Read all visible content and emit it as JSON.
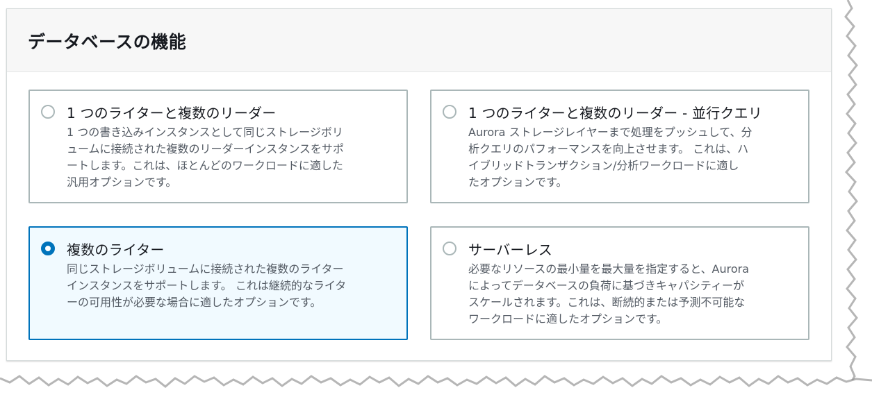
{
  "section": {
    "title": "データベースの機能"
  },
  "options": [
    {
      "title": "1 つのライターと複数のリーダー",
      "description_lines": [
        "1 つの書き込みインスタンスとして同じストレージボリ",
        "ュームに接続された複数のリーダーインスタンスをサポ",
        "ートします。これは、ほとんどのワークロードに適した",
        "汎用オプションです。"
      ],
      "selected": false
    },
    {
      "title": "1 つのライターと複数のリーダー - 並行クエリ",
      "description_lines": [
        "Aurora ストレージレイヤーまで処理をプッシュして、分",
        "析クエリのパフォーマンスを向上させます。 これは、ハ",
        "イブリッドトランザクション/分析ワークロードに適し",
        "たオプションです。"
      ],
      "selected": false
    },
    {
      "title": "複数のライター",
      "description_lines": [
        "同じストレージボリュームに接続された複数のライター",
        "インスタンスをサポートします。 これは継続的なライタ",
        "ーの可用性が必要な場合に適したオプションです。"
      ],
      "selected": true
    },
    {
      "title": "サーバーレス",
      "description_lines": [
        "必要なリソースの最小量を最大量を指定すると、Aurora",
        "によってデータベースの負荷に基づきキャパシティーが",
        "スケールされます。これは、断続的または予測不可能な",
        "ワークロードに適したオプションです。"
      ],
      "selected": false
    }
  ],
  "colors": {
    "accent": "#0073bb",
    "selected_background": "#f1faff",
    "tile_border": "#aab7b8",
    "title_text": "#16191f",
    "description_text": "#545b64",
    "header_background": "#f7f7f7"
  }
}
